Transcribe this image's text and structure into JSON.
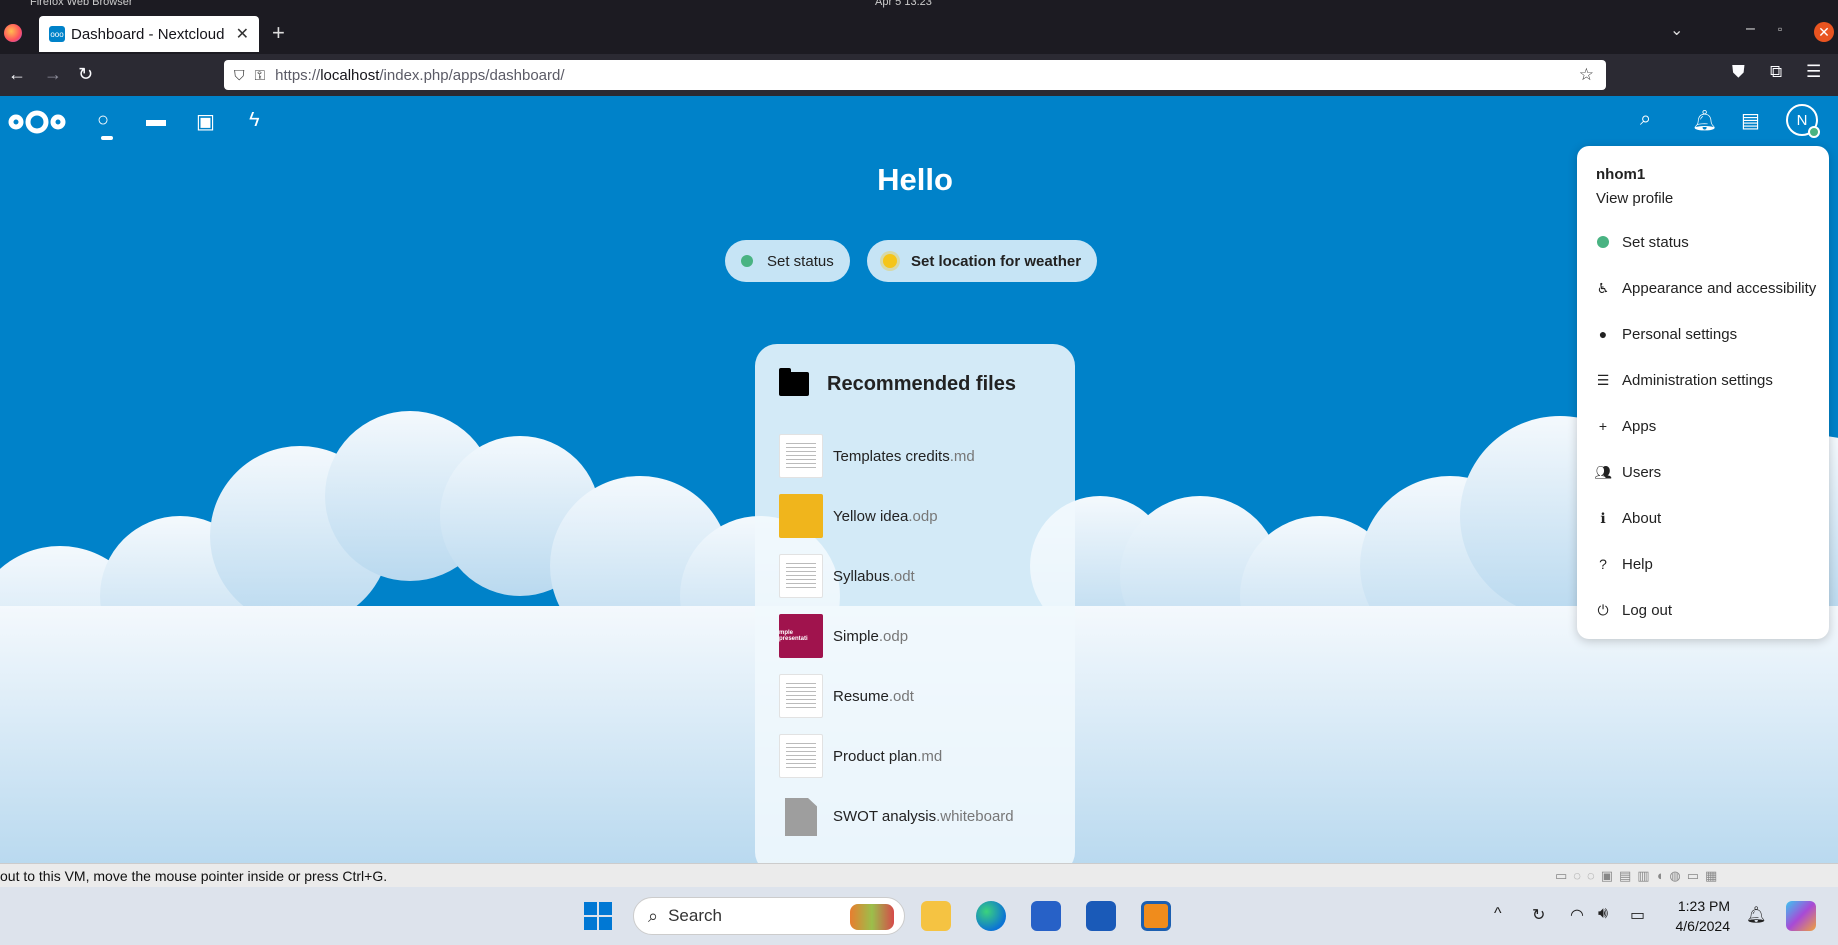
{
  "os": {
    "app_name": "Firefox Web Browser",
    "clock": "Apr 5  13:23"
  },
  "browser": {
    "tab_title": "Dashboard - Nextcloud",
    "url_host": "localhost",
    "url_prefix": "https://",
    "url_path": "/index.php/apps/dashboard/"
  },
  "nextcloud": {
    "greeting": "Hello",
    "set_status_label": "Set status",
    "weather_label": "Set location for weather",
    "avatar_initial": "N",
    "recommended": {
      "title": "Recommended files",
      "files": [
        {
          "name": "Templates credits",
          "ext": ".md"
        },
        {
          "name": "Yellow idea",
          "ext": ".odp"
        },
        {
          "name": "Syllabus",
          "ext": ".odt"
        },
        {
          "name": "Simple",
          "ext": ".odp"
        },
        {
          "name": "Resume",
          "ext": ".odt"
        },
        {
          "name": "Product plan",
          "ext": ".md"
        },
        {
          "name": "SWOT analysis",
          "ext": ".whiteboard"
        }
      ],
      "simple_thumb_text": "mple presentati"
    },
    "menu": {
      "username": "nhom1",
      "view_profile": "View profile",
      "items": [
        {
          "label": "Set status",
          "icon": "status-dot"
        },
        {
          "label": "Appearance and accessibility",
          "icon": "accessibility-icon"
        },
        {
          "label": "Personal settings",
          "icon": "person-icon"
        },
        {
          "label": "Administration settings",
          "icon": "list-icon"
        },
        {
          "label": "Apps",
          "icon": "plus-icon"
        },
        {
          "label": "Users",
          "icon": "users-icon"
        },
        {
          "label": "About",
          "icon": "info-icon"
        },
        {
          "label": "Help",
          "icon": "help-icon"
        },
        {
          "label": "Log out",
          "icon": "power-icon"
        }
      ]
    }
  },
  "vm": {
    "message": "out to this VM, move the mouse pointer inside or press Ctrl+G."
  },
  "taskbar": {
    "search_placeholder": "Search",
    "time": "1:23 PM",
    "date": "4/6/2024"
  }
}
